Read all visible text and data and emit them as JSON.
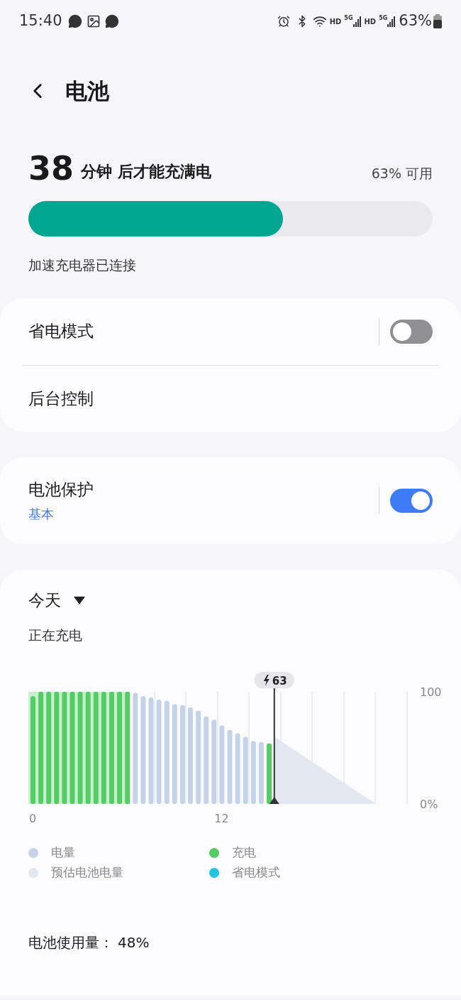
{
  "status_bar": {
    "time": "15:40",
    "hd_labels": [
      "HD",
      "HD"
    ],
    "network_labels": [
      "5G",
      "5G"
    ],
    "battery": "63%"
  },
  "header": {
    "title": "电池"
  },
  "charge": {
    "minutes": "38",
    "remaining_text": "分钟 后才能充满电",
    "available": "63% 可用",
    "level": 0.63,
    "charger_status": "加速充电器已连接"
  },
  "settings_groups": [
    {
      "items": [
        {
          "kind": "toggle",
          "label": "省电模式",
          "on": false
        },
        {
          "kind": "link",
          "label": "后台控制"
        }
      ]
    },
    {
      "items": [
        {
          "kind": "toggle",
          "label": "电池保护",
          "subtitle": "基本",
          "on": true
        }
      ]
    }
  ],
  "usage": {
    "period": "今天",
    "status": "正在充电",
    "chart_data": {
      "type": "bar",
      "stacked": true,
      "x": [
        0,
        0.5,
        1,
        1.5,
        2,
        2.5,
        3,
        3.5,
        4,
        4.5,
        5,
        5.5,
        6,
        6.5,
        7,
        7.5,
        8,
        8.5,
        9,
        9.5,
        10,
        10.5,
        11,
        11.5,
        12,
        12.5,
        13,
        13.5,
        14,
        14.5,
        15
      ],
      "series": [
        {
          "name": "电量",
          "color": "#c5d3e8",
          "values": [
            null,
            null,
            null,
            null,
            null,
            null,
            null,
            null,
            null,
            null,
            null,
            null,
            null,
            99,
            96,
            95,
            93,
            92,
            89,
            88,
            86,
            83,
            78,
            75,
            70,
            66,
            63,
            60,
            56,
            55,
            null
          ]
        },
        {
          "name": "充电",
          "color": "#55cc66",
          "values": [
            96,
            100,
            100,
            100,
            100,
            100,
            100,
            100,
            100,
            100,
            100,
            100,
            100,
            null,
            null,
            null,
            null,
            null,
            null,
            null,
            null,
            null,
            null,
            null,
            null,
            null,
            null,
            null,
            null,
            null,
            54
          ]
        }
      ],
      "xlim": [
        0,
        24
      ],
      "ylim": [
        0,
        100
      ],
      "annotations": [
        "63"
      ],
      "ref_lines": [
        {
          "axis": "x",
          "value": 15.35
        }
      ],
      "xticks": [
        {
          "value": 0,
          "label": "0"
        },
        {
          "value": 12,
          "label": "12"
        }
      ],
      "yticks": [
        {
          "value": 0,
          "label": "0%"
        },
        {
          "value": 100,
          "label": "100"
        }
      ]
    },
    "extra_legend": [
      {
        "label": "预估电池电量",
        "color": "#e3e8f0"
      },
      {
        "label": "省电模式",
        "color": "#22c4e0"
      }
    ],
    "total_label": "电池使用量：",
    "total_value": "48%"
  }
}
